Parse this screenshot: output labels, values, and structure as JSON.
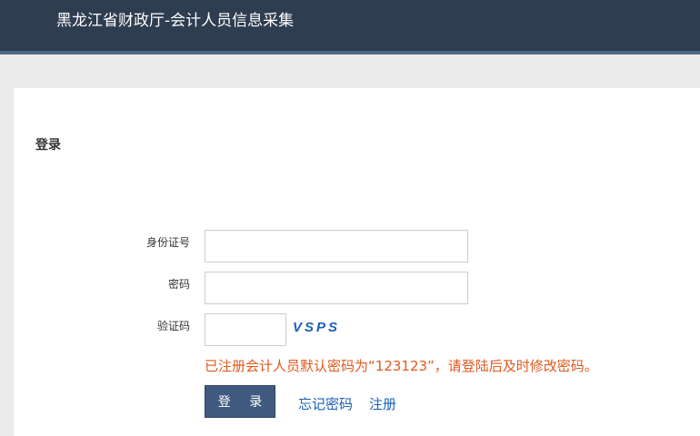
{
  "header": {
    "title": "黑龙江省财政厅-会计人员信息采集"
  },
  "panel": {
    "title": "登录"
  },
  "form": {
    "id_label": "身份证号",
    "id_value": "",
    "password_label": "密码",
    "password_value": "",
    "captcha_label": "验证码",
    "captcha_value": "",
    "captcha_text": "VSPS",
    "notice": "已注册会计人员默认密码为“123123”，请登陆后及时修改密码。",
    "login_label": "登 录",
    "forgot_label": "忘记密码",
    "register_label": "注册"
  },
  "colors": {
    "header_bg": "#2e3d50",
    "button_bg": "#3f5a7e",
    "notice": "#e05a1e",
    "link": "#1a5fb4"
  }
}
